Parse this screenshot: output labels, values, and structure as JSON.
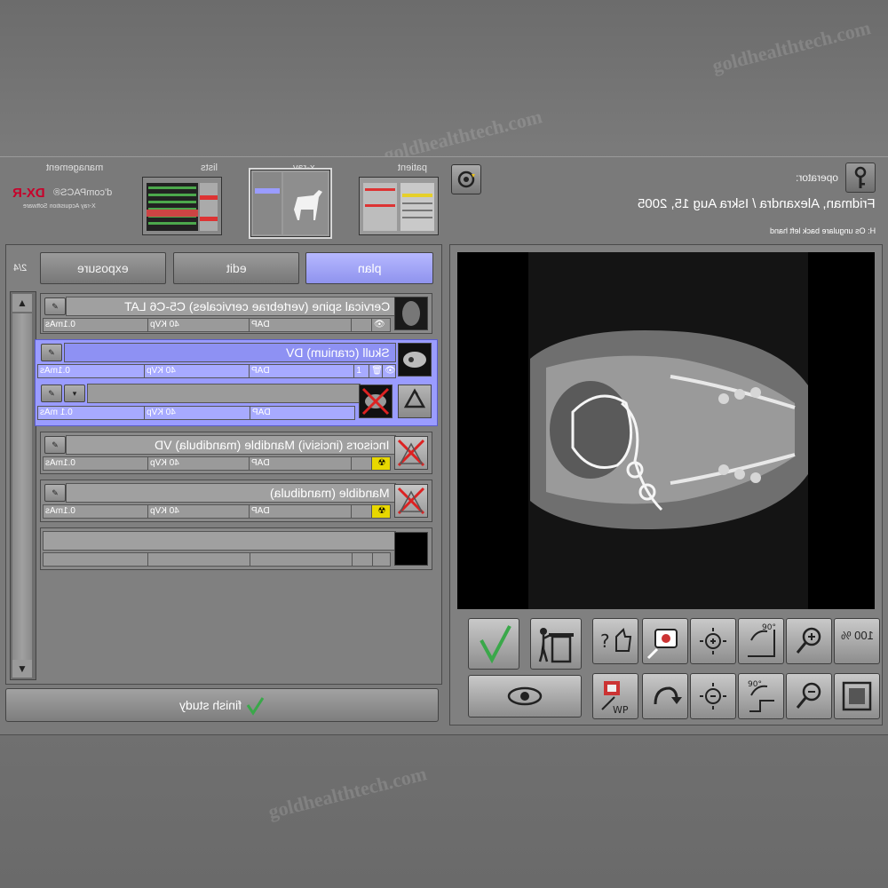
{
  "header": {
    "tabs": [
      {
        "label": "management"
      },
      {
        "label": "lists"
      },
      {
        "label": "x-ray"
      },
      {
        "label": "patient"
      }
    ],
    "logo": {
      "brand": "DX-R",
      "product": "d'comPACS®",
      "subtitle": "X-ray Acquisition Software"
    },
    "operator_label": "operator:",
    "patient_line": "Fridman, Alexandra / Iskra  Aug 15, 2005",
    "info_line": "H: Os ungulare back left hand"
  },
  "plan_panel": {
    "tabs": [
      {
        "label": "exposure"
      },
      {
        "label": "edit"
      },
      {
        "label": "plan",
        "active": true
      }
    ],
    "page_count": "2/4",
    "studies": [
      {
        "title": "Cervical spine (vertebrae cervicales) C5-C6 LAT",
        "mas": "0.1mAs",
        "kvp": "40 KVp",
        "dap": "DAP",
        "count": ""
      },
      {
        "title": "Skull (cranium) DV",
        "mas": "0.1mAs",
        "kvp": "40 KVp",
        "dap": "DAP",
        "count": "1",
        "selected": true
      },
      {
        "title": "",
        "mas": "0.1 mAs",
        "kvp": "40 KVp",
        "dap": "DAP",
        "count": "",
        "selected": true
      },
      {
        "title": "Incisors (incisivi) Mandible (mandibula) VD",
        "mas": "0.1mAs",
        "kvp": "40 KVp",
        "dap": "DAP",
        "count": ""
      },
      {
        "title": "Mandible (mandibula)",
        "mas": "0.1mAs",
        "kvp": "40 KVp",
        "dap": "DAP",
        "count": ""
      },
      {
        "title": "",
        "mas": "",
        "kvp": "",
        "dap": "",
        "count": ""
      }
    ]
  },
  "finish_label": "finish study",
  "toolbar": {
    "zoom_100": "100 %",
    "wp_label": "WP",
    "rotate_90": "90°"
  },
  "watermark": "goldhealthtech.com",
  "colors": {
    "accent": "#9a9cff",
    "brand": "#c8002a",
    "check": "#3aa84a"
  }
}
